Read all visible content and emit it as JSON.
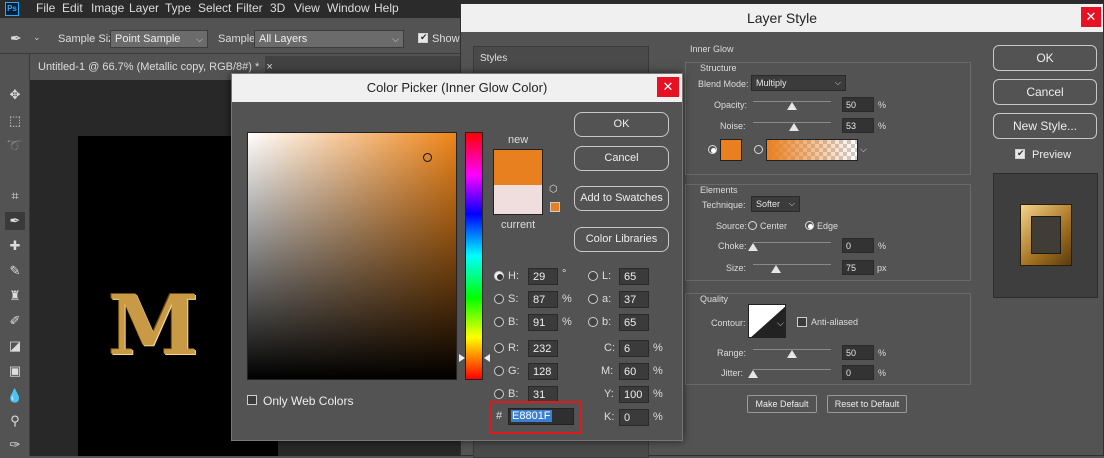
{
  "app": {
    "menu": [
      "File",
      "Edit",
      "Image",
      "Layer",
      "Type",
      "Select",
      "Filter",
      "3D",
      "View",
      "Window",
      "Help"
    ],
    "logo_text": "Ps",
    "options_bar": {
      "sample_size_label": "Sample Size:",
      "sample_size_value": "Point Sample",
      "sample_label": "Sample:",
      "sample_value": "All Layers",
      "show_label": "Show"
    },
    "document_tab": "Untitled-1 @ 66.7% (Metallic copy, RGB/8#) *",
    "document_tab_close": "×",
    "tools": [
      "move-tool",
      "marquee-tool",
      "lasso-tool",
      "crop-tool",
      "eyedropper-tool",
      "healing-tool",
      "brush-tool",
      "stamp-tool",
      "history-brush-tool",
      "eraser-tool",
      "gradient-tool",
      "blur-tool",
      "dodge-tool",
      "pen-tool"
    ]
  },
  "layer_style": {
    "title": "Layer Style",
    "styles_label": "Styles",
    "section_title": "Inner Glow",
    "structure": {
      "title": "Structure",
      "blend_mode_label": "Blend Mode:",
      "blend_mode_value": "Multiply",
      "opacity_label": "Opacity:",
      "opacity_value": "50",
      "opacity_unit": "%",
      "noise_label": "Noise:",
      "noise_value": "53",
      "noise_unit": "%",
      "glow_color": "#e8801f"
    },
    "elements": {
      "title": "Elements",
      "technique_label": "Technique:",
      "technique_value": "Softer",
      "source_label": "Source:",
      "source_center": "Center",
      "source_edge": "Edge",
      "choke_label": "Choke:",
      "choke_value": "0",
      "choke_unit": "%",
      "size_label": "Size:",
      "size_value": "75",
      "size_unit": "px"
    },
    "quality": {
      "title": "Quality",
      "contour_label": "Contour:",
      "anti_aliased_label": "Anti-aliased",
      "range_label": "Range:",
      "range_value": "50",
      "range_unit": "%",
      "jitter_label": "Jitter:",
      "jitter_value": "0",
      "jitter_unit": "%"
    },
    "make_default": "Make Default",
    "reset_default": "Reset to Default",
    "buttons": {
      "ok": "OK",
      "cancel": "Cancel",
      "new_style": "New Style...",
      "preview": "Preview"
    },
    "slider_levels_percent": {
      "opacity": 50,
      "noise": 53,
      "choke": 0,
      "size": 30,
      "range": 50,
      "jitter": 0
    }
  },
  "color_picker": {
    "title": "Color Picker (Inner Glow Color)",
    "new_label": "new",
    "current_label": "current",
    "new_color": "#e8801f",
    "current_color": "#f0dede",
    "buttons": {
      "ok": "OK",
      "cancel": "Cancel",
      "add_swatches": "Add to Swatches",
      "color_libraries": "Color Libraries"
    },
    "only_web_colors": "Only Web Colors",
    "hsb": [
      {
        "label": "H:",
        "value": "29",
        "unit": "°"
      },
      {
        "label": "S:",
        "value": "87",
        "unit": "%"
      },
      {
        "label": "B:",
        "value": "91",
        "unit": "%"
      }
    ],
    "rgb": [
      {
        "label": "R:",
        "value": "232"
      },
      {
        "label": "G:",
        "value": "128"
      },
      {
        "label": "B:",
        "value": "31"
      }
    ],
    "lab": [
      {
        "label": "L:",
        "value": "65"
      },
      {
        "label": "a:",
        "value": "37"
      },
      {
        "label": "b:",
        "value": "65"
      }
    ],
    "cmyk": [
      {
        "label": "C:",
        "value": "6",
        "unit": "%"
      },
      {
        "label": "M:",
        "value": "60",
        "unit": "%"
      },
      {
        "label": "Y:",
        "value": "100",
        "unit": "%"
      },
      {
        "label": "K:",
        "value": "0",
        "unit": "%"
      }
    ],
    "hex_hash": "#",
    "hex_value": "E8801F"
  }
}
